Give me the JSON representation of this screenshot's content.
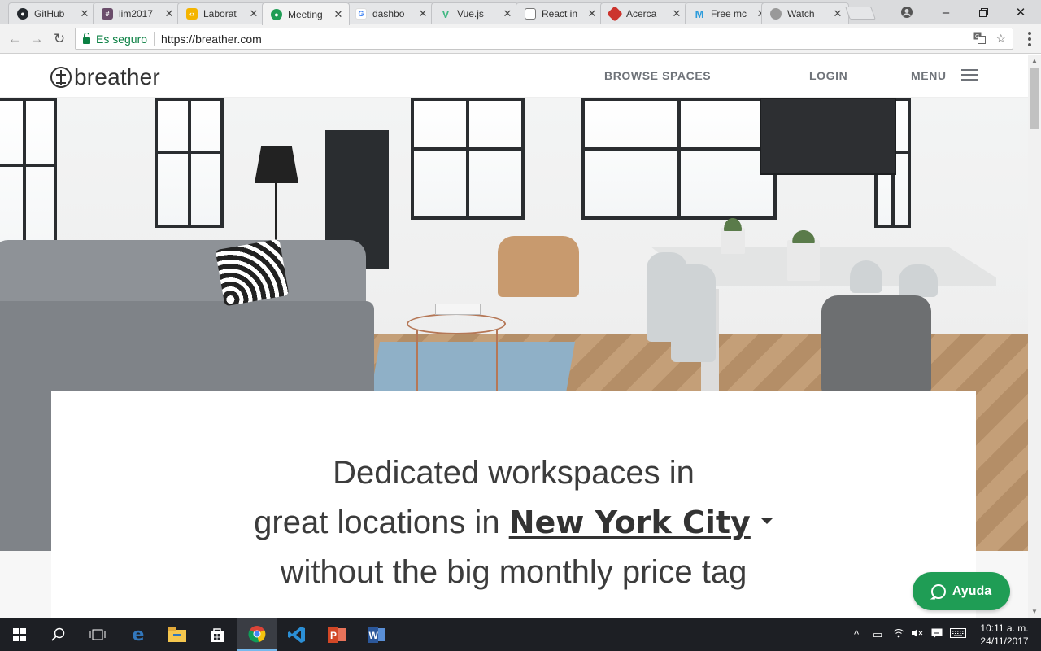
{
  "browser": {
    "tabs": [
      {
        "title": "GitHub",
        "icon": "github-icon",
        "color": "#24292e",
        "active": false
      },
      {
        "title": "lim2017",
        "icon": "slack-hash-icon",
        "color": "#6b4d6b",
        "active": false
      },
      {
        "title": "Laborat",
        "icon": "code-doc-icon",
        "color": "#f4b400",
        "active": false
      },
      {
        "title": "Meeting",
        "icon": "breather-icon",
        "color": "#1f9d55",
        "active": true
      },
      {
        "title": "dashbo",
        "icon": "google-icon",
        "color": "#4285f4",
        "active": false
      },
      {
        "title": "Vue.js",
        "icon": "vue-icon",
        "color": "#41b883",
        "active": false
      },
      {
        "title": "React in",
        "icon": "page-icon",
        "color": "#9e9e9e",
        "active": false
      },
      {
        "title": "Acerca",
        "icon": "ruby-icon",
        "color": "#cc342d",
        "active": false
      },
      {
        "title": "Free mc",
        "icon": "m-logo-icon",
        "color": "#2d9cdb",
        "active": false
      },
      {
        "title": "Watch",
        "icon": "apple-icon",
        "color": "#999999",
        "active": false
      }
    ],
    "omnibox": {
      "secure_label": "Es seguro",
      "url": "https://breather.com"
    }
  },
  "site": {
    "logo_text": "breather",
    "nav": {
      "browse": "BROWSE SPACES",
      "login": "LOGIN",
      "menu": "MENU"
    },
    "hero": {
      "line1": "Dedicated workspaces in",
      "line2_prefix": "great locations in",
      "city": "New York City",
      "line3": "without the big monthly price tag"
    },
    "help_button": "Ayuda",
    "accent": "#1f9d55"
  },
  "taskbar": {
    "time": "10:11 a. m.",
    "date": "24/11/2017",
    "apps": [
      "start-icon",
      "search-icon",
      "task-view-icon",
      "edge-icon",
      "file-explorer-icon",
      "store-icon",
      "chrome-icon",
      "vscode-icon",
      "powerpoint-icon",
      "word-icon"
    ]
  }
}
